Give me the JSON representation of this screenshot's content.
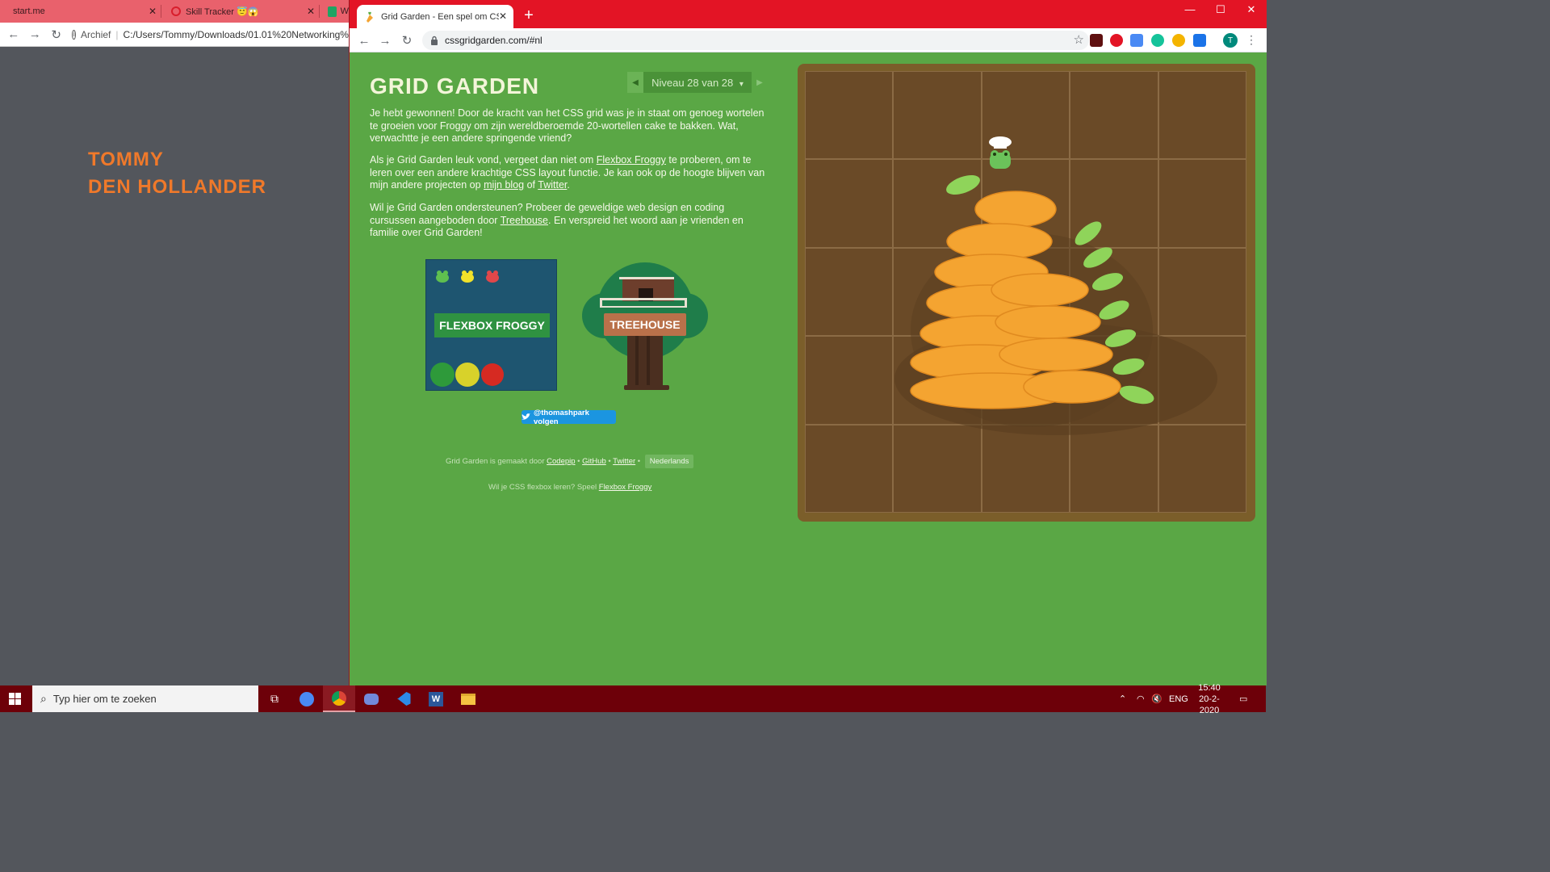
{
  "left_window": {
    "tabs": [
      {
        "label": "start.me"
      },
      {
        "label": "Skill Tracker 😇😱"
      },
      {
        "label": "W"
      }
    ],
    "omnibox": {
      "security_label": "Archief",
      "url": "C:/Users/Tommy/Downloads/01.01%20Networking%"
    },
    "name_line1": "TOMMY",
    "name_line2": "DEN HOLLANDER"
  },
  "browser": {
    "tab_title": "Grid Garden - Een spel om CSS g",
    "url": "cssgridgarden.com/#nl",
    "profile_initial": "T",
    "new_tab": "+",
    "minimize": "—",
    "maximize": "☐",
    "close": "✕"
  },
  "game": {
    "title": "GRID GARDEN",
    "level": {
      "label": "Niveau 28 van 28",
      "prev": "◀",
      "next": "▶",
      "dropdown": "▾"
    },
    "para1": "Je hebt gewonnen! Door de kracht van het CSS grid was je in staat om genoeg wortelen te groeien voor Froggy om zijn wereldberoemde 20-wortellen cake te bakken. Wat, verwachtte je een andere springende vriend?",
    "para2": {
      "t1": "Als je Grid Garden leuk vond, vergeet dan niet om ",
      "link1": "Flexbox Froggy",
      "t2": " te proberen, om te leren over een andere krachtige CSS layout functie. Je kan ook op de hoogte blijven van mijn andere projecten op ",
      "link2": "mijn blog",
      "t3": " of ",
      "link3": "Twitter",
      "t4": "."
    },
    "para3": {
      "t1": "Wil je Grid Garden ondersteunen? Probeer de geweldige web design en coding cursussen aangeboden door ",
      "link1": "Treehouse",
      "t2": ". En verspreid het woord aan je vrienden en familie over Grid Garden!"
    },
    "froggy_label": "FLEXBOX FROGGY",
    "treehouse_label": "TREEHOUSE",
    "twitter_button": "@thomashpark volgen",
    "footer1": {
      "text": "Grid Garden is gemaakt door ",
      "link1": "Codepip",
      "sep": " • ",
      "link2": "GitHub",
      "link3": "Twitter",
      "lang": "Nederlands"
    },
    "footer2": {
      "text": "Wil je CSS flexbox leren? Speel ",
      "link": "Flexbox Froggy"
    }
  },
  "taskbar": {
    "search_placeholder": "Typ hier om te zoeken",
    "language": "ENG",
    "time": "15:40",
    "date": "20-2-2020"
  },
  "colors": {
    "page_green": "#5aa745",
    "titlebar_red": "#e31425",
    "name_orange": "#f0792a",
    "taskbar": "#6d0009",
    "carrot": "#f4a431"
  }
}
